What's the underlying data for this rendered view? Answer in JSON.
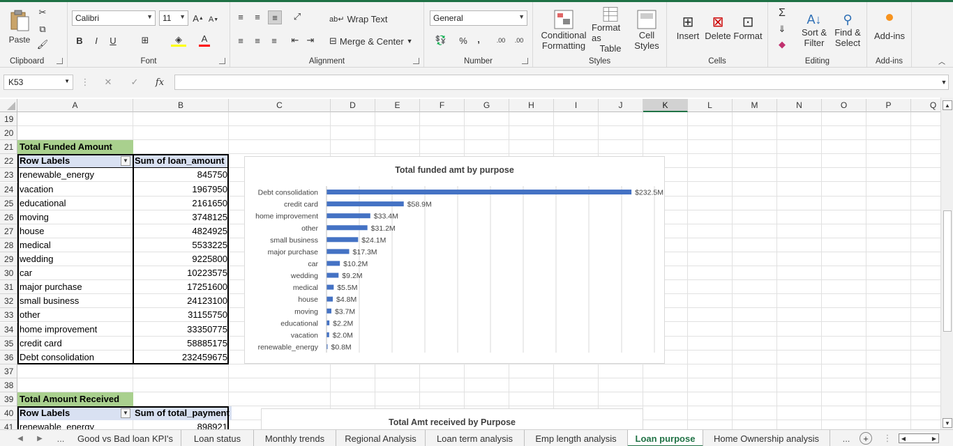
{
  "ribbon": {
    "clipboard": {
      "label": "Clipboard",
      "paste": "Paste"
    },
    "font": {
      "label": "Font",
      "name": "Calibri",
      "size": "11",
      "bold": "B",
      "italic": "I",
      "underline": "U",
      "grow": "A",
      "shrink": "A",
      "font_color": "A"
    },
    "alignment": {
      "label": "Alignment",
      "wrap_text": "Wrap Text",
      "merge_center": "Merge & Center"
    },
    "number": {
      "label": "Number",
      "format": "General",
      "percent": "%",
      "comma": ",",
      "inc_decimal": ".00",
      "dec_decimal": ".00"
    },
    "styles": {
      "label": "Styles",
      "conditional": "Conditional",
      "conditional2": "Formatting",
      "format_as": "Format as",
      "format_as2": "Table",
      "cell": "Cell",
      "cell2": "Styles"
    },
    "cells": {
      "label": "Cells",
      "insert": "Insert",
      "delete": "Delete",
      "format": "Format"
    },
    "editing": {
      "label": "Editing",
      "sort1": "Sort &",
      "sort2": "Filter",
      "find1": "Find &",
      "find2": "Select"
    },
    "addins": {
      "label": "Add-ins",
      "button": "Add-ins"
    }
  },
  "formula_bar": {
    "name_box": "K53",
    "fx": "fx",
    "formula": ""
  },
  "columns": [
    "A",
    "B",
    "C",
    "D",
    "E",
    "F",
    "G",
    "H",
    "I",
    "J",
    "K",
    "L",
    "M",
    "N",
    "O",
    "P",
    "Q"
  ],
  "selected_column": "K",
  "rows": [
    "19",
    "20",
    "21",
    "22",
    "23",
    "24",
    "25",
    "26",
    "27",
    "28",
    "29",
    "30",
    "31",
    "32",
    "33",
    "34",
    "35",
    "36",
    "37",
    "38",
    "39",
    "40",
    "41"
  ],
  "pivot1": {
    "title": "Total Funded Amount",
    "header_label": "Row Labels",
    "header_value": "Sum of loan_amount",
    "items": [
      {
        "label": "renewable_energy",
        "value": "845750"
      },
      {
        "label": "vacation",
        "value": "1967950"
      },
      {
        "label": "educational",
        "value": "2161650"
      },
      {
        "label": "moving",
        "value": "3748125"
      },
      {
        "label": "house",
        "value": "4824925"
      },
      {
        "label": "medical",
        "value": "5533225"
      },
      {
        "label": "wedding",
        "value": "9225800"
      },
      {
        "label": "car",
        "value": "10223575"
      },
      {
        "label": "major purchase",
        "value": "17251600"
      },
      {
        "label": "small business",
        "value": "24123100"
      },
      {
        "label": "other",
        "value": "31155750"
      },
      {
        "label": "home improvement",
        "value": "33350775"
      },
      {
        "label": "credit card",
        "value": "58885175"
      },
      {
        "label": "Debt consolidation",
        "value": "232459675"
      }
    ]
  },
  "pivot2": {
    "title": "Total Amount Received",
    "header_label": "Row Labels",
    "header_value": "Sum of total_payment",
    "first_label": "renewable_energy",
    "first_value": "898921"
  },
  "chart_data": [
    {
      "type": "bar",
      "title": "Total funded amt by purpose",
      "orientation": "horizontal",
      "categories": [
        "Debt consolidation",
        "credit card",
        "home improvement",
        "other",
        "small business",
        "major purchase",
        "car",
        "wedding",
        "medical",
        "house",
        "moving",
        "educational",
        "vacation",
        "renewable_energy"
      ],
      "values": [
        232.5,
        58.9,
        33.4,
        31.2,
        24.1,
        17.3,
        10.2,
        9.2,
        5.5,
        4.8,
        3.7,
        2.2,
        2.0,
        0.8
      ],
      "data_labels": [
        "$232.5M",
        "$58.9M",
        "$33.4M",
        "$31.2M",
        "$24.1M",
        "$17.3M",
        "$10.2M",
        "$9.2M",
        "$5.5M",
        "$4.8M",
        "$3.7M",
        "$2.2M",
        "$2.0M",
        "$0.8M"
      ],
      "xlim": [
        0,
        250
      ],
      "grid": true,
      "color": "#4472c4"
    },
    {
      "type": "bar",
      "title": "Total Amt received by Purpose"
    }
  ],
  "sheet_tabs": [
    "Good vs Bad loan KPI's",
    "Loan status",
    "Monthly trends",
    "Regional Analysis",
    "Loan term analysis",
    "Emp length analysis",
    "Loan purpose",
    "Home Ownership analysis"
  ],
  "active_tab": "Loan purpose",
  "tab_more": "...",
  "colors": {
    "excel_green": "#217346",
    "header_fill": "#d9e1f2",
    "title_fill": "#a9d08e",
    "bar": "#4472c4"
  }
}
